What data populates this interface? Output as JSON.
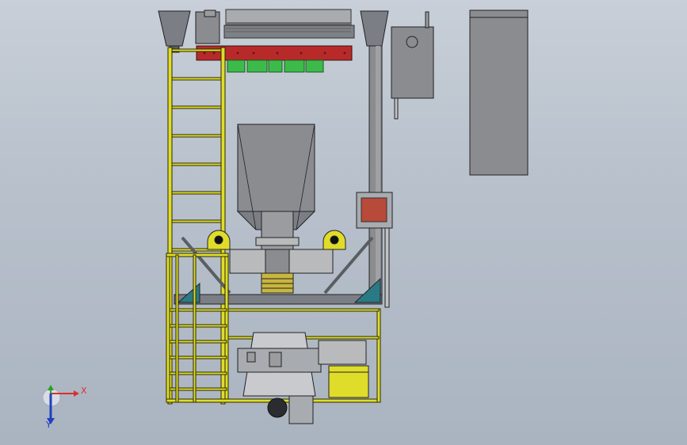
{
  "triad": {
    "x_label": "X",
    "y_label": "Y",
    "x_color": "#d83030",
    "y_color": "#2aa02a",
    "z_color": "#2040c0"
  },
  "palette": {
    "ladder_yellow": "#e0dc2a",
    "steel_gray": "#8a8c90",
    "red_beam": "#b82a2a",
    "green_blocks": "#3dbb4a",
    "teal": "#2a7a86"
  }
}
